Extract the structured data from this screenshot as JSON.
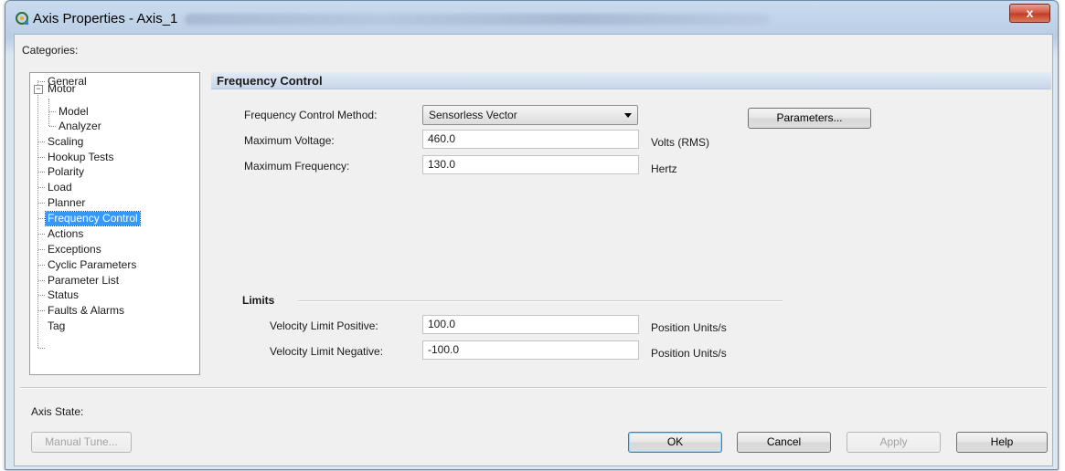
{
  "window": {
    "title": "Axis Properties - Axis_1",
    "close_label": "x"
  },
  "categories": {
    "label": "Categories:",
    "items": [
      {
        "label": "General"
      },
      {
        "label": "Motor"
      },
      {
        "label": "Model"
      },
      {
        "label": "Analyzer"
      },
      {
        "label": "Scaling"
      },
      {
        "label": "Hookup Tests"
      },
      {
        "label": "Polarity"
      },
      {
        "label": "Load"
      },
      {
        "label": "Planner"
      },
      {
        "label": "Frequency Control",
        "selected": true
      },
      {
        "label": "Actions"
      },
      {
        "label": "Exceptions"
      },
      {
        "label": "Cyclic Parameters"
      },
      {
        "label": "Parameter List"
      },
      {
        "label": "Status"
      },
      {
        "label": "Faults & Alarms"
      },
      {
        "label": "Tag"
      }
    ],
    "motor_expander": "−"
  },
  "section": {
    "title": "Frequency Control"
  },
  "frequency": {
    "method_label": "Frequency Control Method:",
    "method_value": "Sensorless Vector",
    "parameters_button": "Parameters...",
    "voltage_label": "Maximum Voltage:",
    "voltage_value": "460.0",
    "voltage_unit": "Volts (RMS)",
    "frequency_label": "Maximum Frequency:",
    "frequency_value": "130.0",
    "frequency_unit": "Hertz"
  },
  "limits": {
    "title": "Limits",
    "pos_label": "Velocity Limit Positive:",
    "pos_value": "100.0",
    "pos_unit": "Position Units/s",
    "neg_label": "Velocity Limit Negative:",
    "neg_value": "-100.0",
    "neg_unit": "Position Units/s"
  },
  "footer": {
    "axis_state_label": "Axis State:",
    "manual_tune": "Manual Tune...",
    "ok": "OK",
    "cancel": "Cancel",
    "apply": "Apply",
    "help": "Help"
  },
  "colors": {
    "selection": "#3399ff",
    "header_bg": "#c7d6e9",
    "close_button": "#c13a22"
  }
}
